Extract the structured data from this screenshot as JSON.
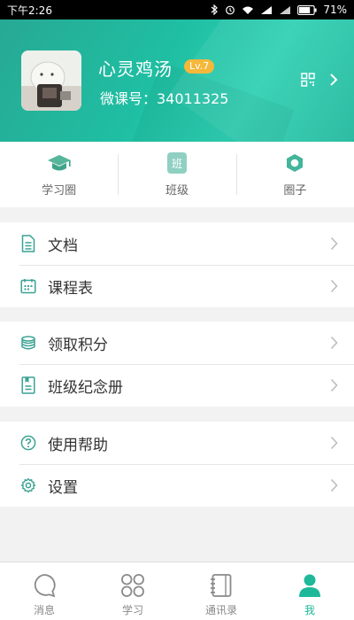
{
  "status_bar": {
    "time": "下午2:26",
    "battery": "71%"
  },
  "profile": {
    "nickname": "心灵鸡汤",
    "level": "Lv.7",
    "weike_id": "微课号：34011325"
  },
  "shortcuts": [
    {
      "label": "学习圈",
      "icon": "graduation-cap-icon"
    },
    {
      "label": "班级",
      "icon": "class-icon",
      "icon_text": "班"
    },
    {
      "label": "圈子",
      "icon": "hexagon-icon"
    }
  ],
  "menu": {
    "group1": [
      {
        "label": "文档",
        "icon": "document-icon"
      },
      {
        "label": "课程表",
        "icon": "calendar-icon"
      }
    ],
    "group2": [
      {
        "label": "领取积分",
        "icon": "coins-icon"
      },
      {
        "label": "班级纪念册",
        "icon": "album-icon"
      }
    ],
    "group3": [
      {
        "label": "使用帮助",
        "icon": "help-icon"
      },
      {
        "label": "设置",
        "icon": "gear-icon"
      }
    ]
  },
  "tabbar": [
    {
      "label": "消息",
      "icon": "message-icon",
      "active": false
    },
    {
      "label": "学习",
      "icon": "grid-icon",
      "active": false
    },
    {
      "label": "通讯录",
      "icon": "contacts-icon",
      "active": false
    },
    {
      "label": "我",
      "icon": "person-icon",
      "active": true
    }
  ],
  "colors": {
    "accent": "#1fb89a",
    "level_badge": "#f5b83a",
    "icon_teal": "#3aa293"
  }
}
